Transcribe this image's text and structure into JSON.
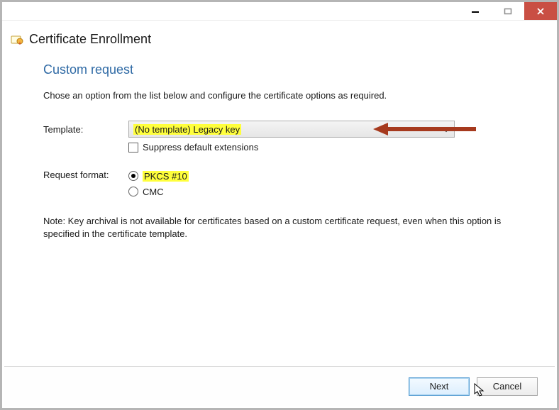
{
  "window": {
    "title": "Certificate Enrollment"
  },
  "section": {
    "heading": "Custom request",
    "instruction": "Chose an option from the list below and configure the certificate options as required."
  },
  "form": {
    "template_label": "Template:",
    "template_value": "(No template) Legacy key",
    "suppress_label": "Suppress default extensions",
    "request_format_label": "Request format:",
    "format_options": {
      "pkcs10": "PKCS #10",
      "cmc": "CMC"
    }
  },
  "note": "Note: Key archival is not available for certificates based on a custom certificate request, even when this option is specified in the certificate template.",
  "buttons": {
    "next": "Next",
    "cancel": "Cancel"
  }
}
